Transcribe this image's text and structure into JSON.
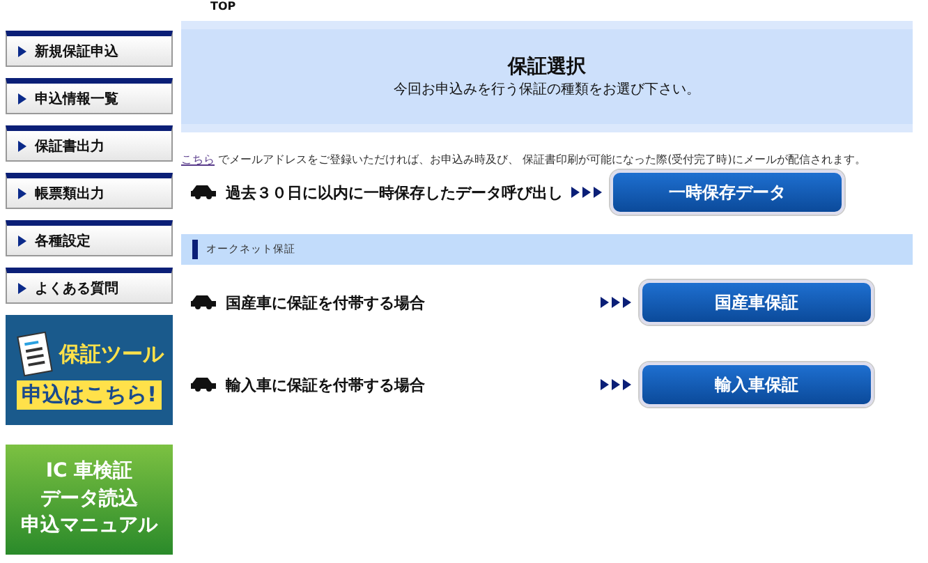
{
  "breadcrumb": "TOP",
  "sidebar": {
    "items": [
      {
        "label": "新規保証申込"
      },
      {
        "label": "申込情報一覧"
      },
      {
        "label": "保証書出力"
      },
      {
        "label": "帳票類出力"
      },
      {
        "label": "各種設定"
      },
      {
        "label": "よくある質問"
      }
    ],
    "banners": [
      {
        "kind": "tool",
        "line_1": "保証ツール",
        "line_2": "申込はこちら!"
      },
      {
        "kind": "manual",
        "line_1": "IC 車検証",
        "line_2": "データ読込",
        "line_3": "申込マニュアル"
      }
    ]
  },
  "header": {
    "title": "保証選択",
    "subtitle": "今回お申込みを行う保証の種類をお選び下さい。"
  },
  "notice": {
    "link": "こちら",
    "text": "でメールアドレスをご登録いただければ、お申込み時及び、 保証書印刷が可能になった際(受付完了時)にメールが配信されます。"
  },
  "saved_row": {
    "label": "過去３０日に以内に一時保存したデータ呼び出し",
    "button": "一時保存データ"
  },
  "section": {
    "title": "オークネット保証",
    "rows": [
      {
        "label": "国産車に保証を付帯する場合",
        "button": "国産車保証"
      },
      {
        "label": "輸入車に保証を付帯する場合",
        "button": "輸入車保証"
      }
    ]
  }
}
